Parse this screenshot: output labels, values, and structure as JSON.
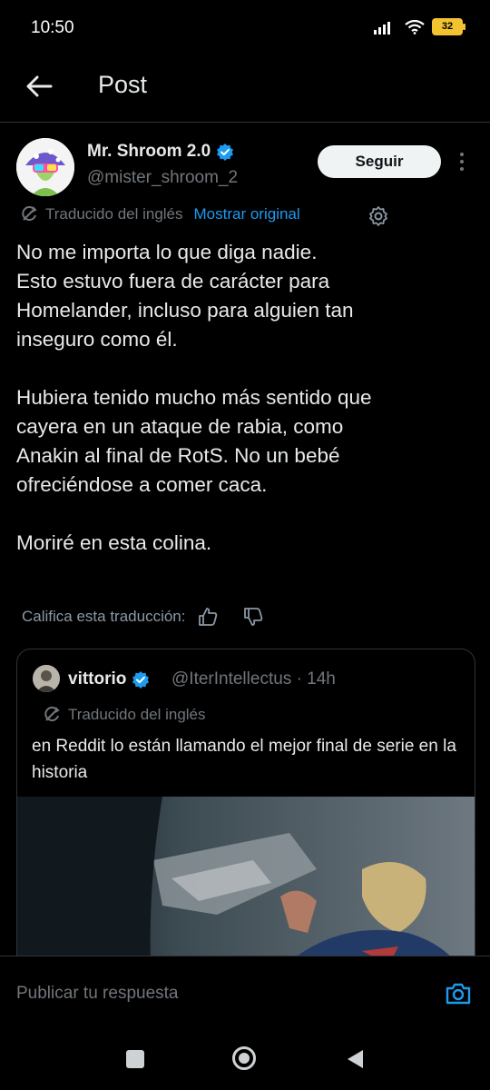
{
  "status": {
    "time": "10:50",
    "battery": "32"
  },
  "header": {
    "title": "Post"
  },
  "author": {
    "name": "Mr. Shroom 2.0",
    "handle": "@mister_shroom_2"
  },
  "actions": {
    "follow_label": "Seguir"
  },
  "translation": {
    "label": "Traducido del inglés",
    "show_original": "Mostrar original"
  },
  "post": {
    "text": "No me importa lo que diga nadie.\nEsto estuvo fuera de carácter para\nHomelander, incluso para alguien tan\ninseguro como él.\n\nHubiera tenido mucho más sentido que\ncayera en un ataque de rabia, como\nAnakin al final de RotS. No un bebé\nofreciéndose a comer caca.\n\nMoriré en esta colina."
  },
  "rate": {
    "label": "Califica esta traducción:"
  },
  "quote": {
    "name": "vittorio",
    "handle": "@IterIntellectus · 14h",
    "translation_label": "Traducido del inglés",
    "text": "en Reddit lo están llamando el mejor final de serie en la historia"
  },
  "reply": {
    "placeholder": "Publicar tu respuesta"
  },
  "colors": {
    "accent": "#1d9bf0",
    "background": "#000000",
    "verified": "#1d9bf0"
  }
}
